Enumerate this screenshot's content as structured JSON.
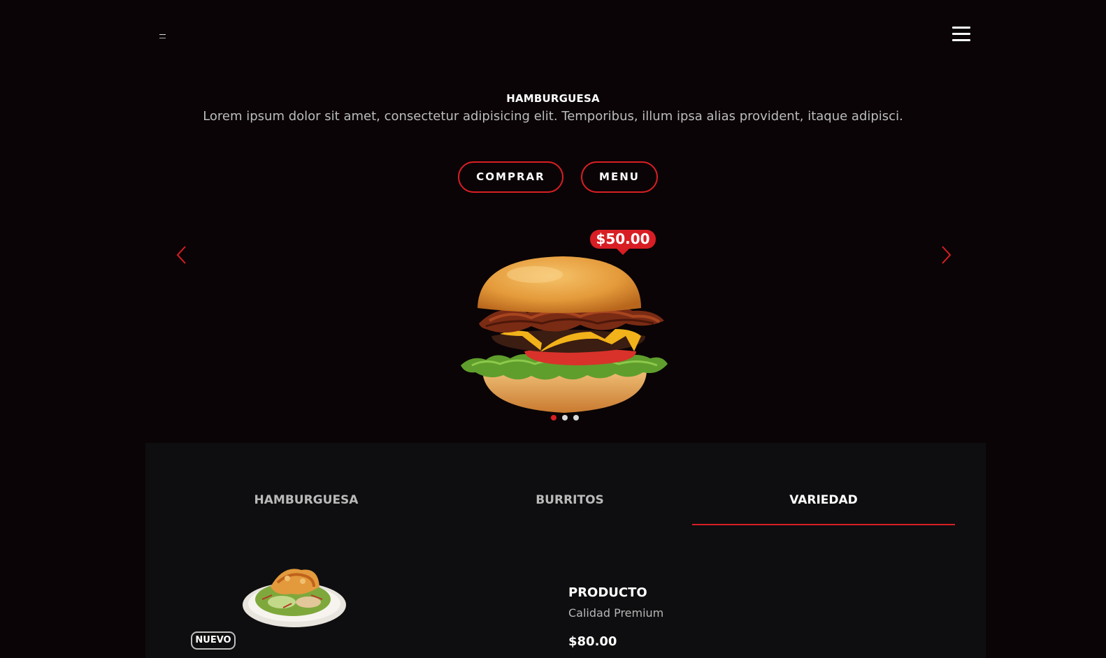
{
  "header": {
    "logo_icon": "logo-mark",
    "menu_icon": "hamburger-menu-icon"
  },
  "hero": {
    "title": "HAMBURGUESA",
    "description": "Lorem ipsum dolor sit amet, consectetur adipisicing elit. Temporibus, illum ipsa alias provident, itaque adipisci.",
    "buttons": {
      "comprar_label": "COMPRAR",
      "menu_label": "MENU"
    }
  },
  "carousel": {
    "price": "$50.00",
    "slide_count": 3,
    "active_slide": 1,
    "prev_icon": "chevron-left-icon",
    "next_icon": "chevron-right-icon"
  },
  "menu_section": {
    "tabs": [
      {
        "label": "HAMBURGUESA",
        "active": false
      },
      {
        "label": "BURRITOS",
        "active": false
      },
      {
        "label": "VARIEDAD",
        "active": true
      }
    ],
    "product": {
      "badge": "NUEVO",
      "name": "PRODUCTO",
      "quality": "Calidad Premium",
      "price": "$80.00"
    }
  },
  "colors": {
    "background": "#0a0406",
    "panel": "#0e0e10",
    "accent": "#d81e24",
    "text": "#ffffff",
    "muted": "#bcbcbc"
  }
}
